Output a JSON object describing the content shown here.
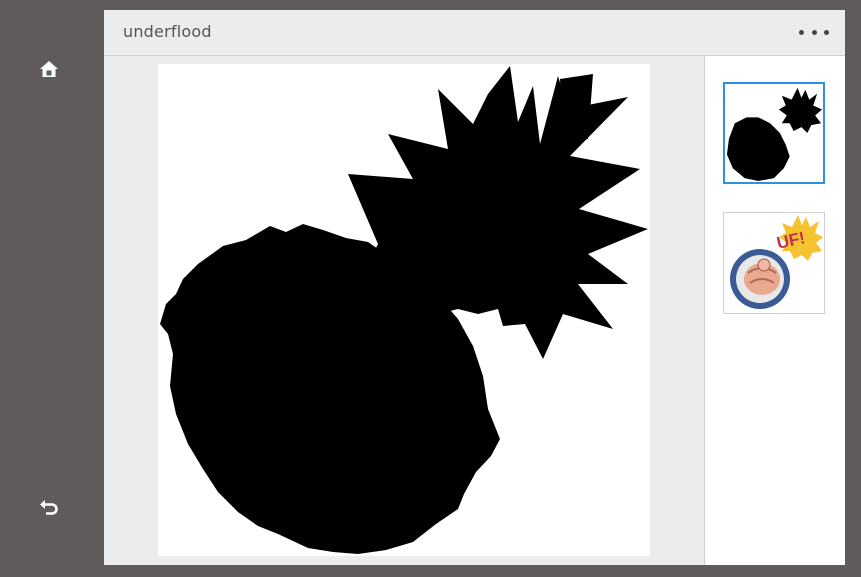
{
  "app": {
    "title": "underflood"
  },
  "left_rail": {
    "items": [
      {
        "icon": "home-icon"
      },
      {
        "icon": "back-arrow-icon"
      }
    ]
  },
  "toolbar": {
    "more_icon": "more-options-icon"
  },
  "thumbnails": [
    {
      "name": "thumbnail-mask",
      "selected": true
    },
    {
      "name": "thumbnail-original",
      "selected": false,
      "caption": "UF!"
    }
  ],
  "colors": {
    "selection": "#2f8fe0",
    "frame": "#5f5b5a",
    "panel_header": "#ececee"
  }
}
